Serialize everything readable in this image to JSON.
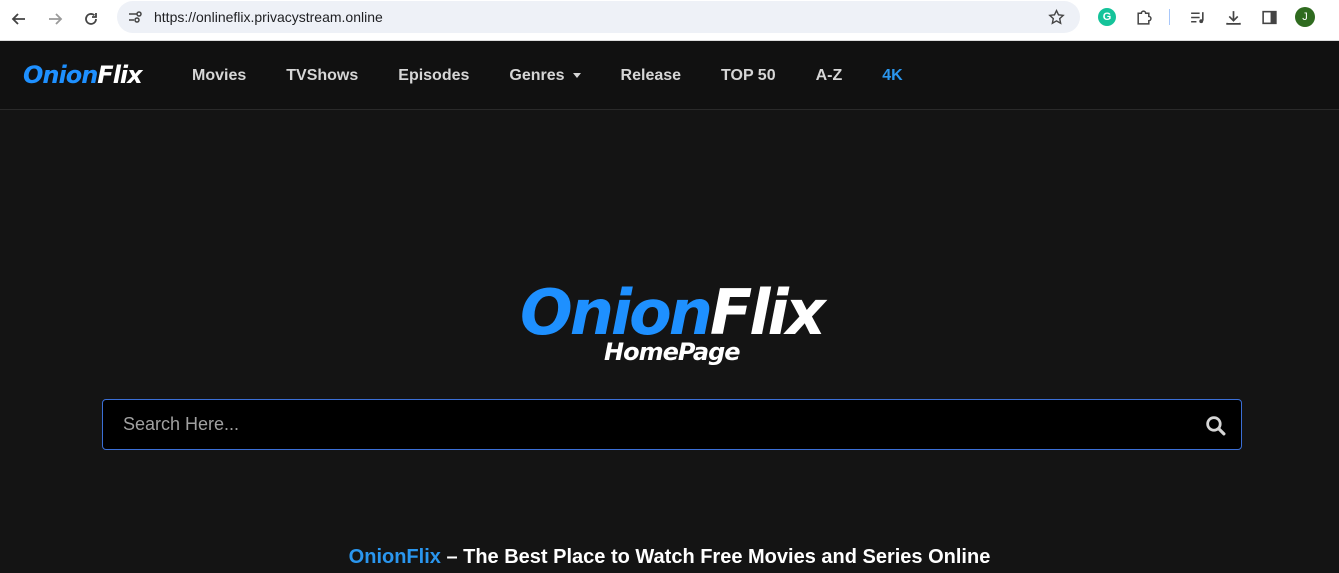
{
  "browser": {
    "url": "https://onlineflix.privacystream.online",
    "profile_initial": "J",
    "grammarly_letter": "G"
  },
  "site": {
    "logo": {
      "part1": "Onion",
      "part2": "Flix"
    },
    "menu": [
      {
        "label": "Movies"
      },
      {
        "label": "TVShows"
      },
      {
        "label": "Episodes"
      },
      {
        "label": "Genres"
      },
      {
        "label": "Release"
      },
      {
        "label": "TOP 50"
      },
      {
        "label": "A-Z"
      },
      {
        "label": "4K"
      }
    ]
  },
  "hero": {
    "logo_part1": "Onion",
    "logo_part2": "Flix",
    "subtitle": "HomePage"
  },
  "search": {
    "placeholder": "Search Here..."
  },
  "tagline": {
    "brand": "OnionFlix",
    "rest": " – The Best Place to Watch Free Movies and Series Online"
  },
  "colors": {
    "accent": "#1e90ff",
    "background": "#141414",
    "header": "#111111"
  }
}
